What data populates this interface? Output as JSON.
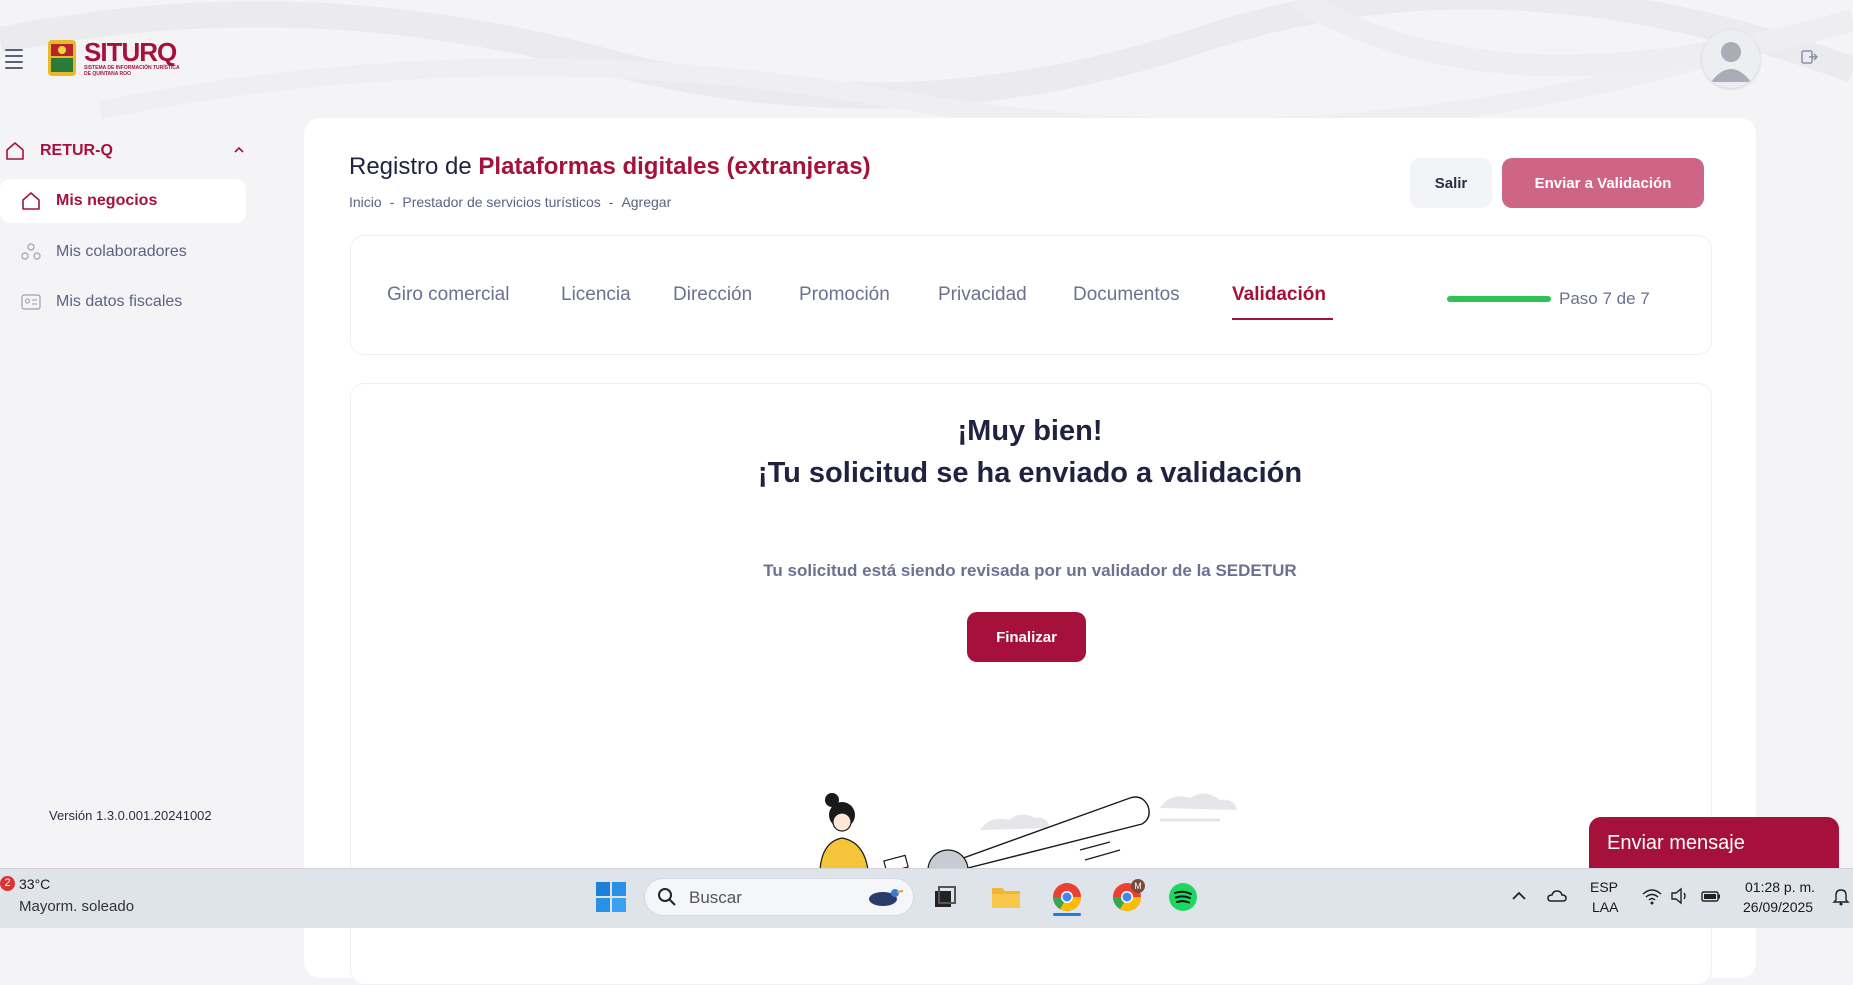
{
  "app": {
    "brand": "SITURQ",
    "brand_sub": "SISTEMA DE INFORMACIÓN TURÍSTICA DE QUINTANA ROO"
  },
  "sidebar": {
    "group_label": "RETUR-Q",
    "items": [
      {
        "label": "Mis negocios",
        "icon": "home-icon",
        "active": true
      },
      {
        "label": "Mis colaboradores",
        "icon": "users-icon",
        "active": false
      },
      {
        "label": "Mis datos fiscales",
        "icon": "id-card-icon",
        "active": false
      }
    ],
    "version": "Versión 1.3.0.001.20241002"
  },
  "header": {
    "title_prefix": "Registro de",
    "title_accent": "Plataformas digitales (extranjeras)",
    "breadcrumb": [
      "Inicio",
      "-",
      "Prestador de servicios turísticos",
      "-",
      "Agregar"
    ],
    "salir_label": "Salir",
    "enviar_label": "Enviar a Validación"
  },
  "tabs": [
    {
      "label": "Giro comercial",
      "active": false
    },
    {
      "label": "Licencia",
      "active": false
    },
    {
      "label": "Dirección",
      "active": false
    },
    {
      "label": "Promoción",
      "active": false
    },
    {
      "label": "Privacidad",
      "active": false
    },
    {
      "label": "Documentos",
      "active": false
    },
    {
      "label": "Validación",
      "active": true
    }
  ],
  "progress": {
    "fraction": 1.0,
    "label": "Paso 7 de 7",
    "color": "#2fc154"
  },
  "result": {
    "heading_1": "¡Muy bien!",
    "heading_2": "¡Tu solicitud se ha enviado a validación",
    "description": "Tu solicitud está siendo revisada por un validador de la SEDETUR",
    "finalize_label": "Finalizar"
  },
  "chat": {
    "label": "Enviar mensaje"
  },
  "taskbar": {
    "weather_badge": "2",
    "temperature": "33°C",
    "condition": "Mayorm. soleado",
    "search_placeholder": "Buscar",
    "language_1": "ESP",
    "language_2": "LAA",
    "time": "01:28 p. m.",
    "date": "26/09/2025",
    "chrome_badge": "M"
  },
  "colors": {
    "accent": "#a6113c",
    "accent_light": "#cf6586",
    "text_dark": "#1f2340",
    "text_muted": "#6b7190"
  }
}
